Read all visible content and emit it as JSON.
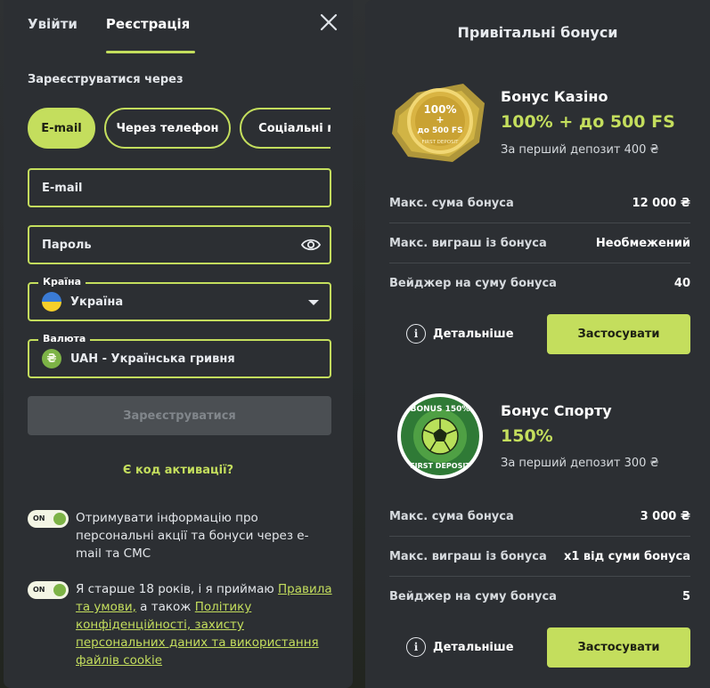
{
  "left": {
    "tabs": [
      "Увійти",
      "Реєстрація"
    ],
    "active_tab": 1,
    "register_via": "Зареєструватися через",
    "methods": [
      "E-mail",
      "Через телефон",
      "Соціальні м"
    ],
    "email": {
      "placeholder": "E-mail",
      "value": ""
    },
    "password": {
      "placeholder": "Пароль",
      "value": ""
    },
    "country": {
      "label": "Країна",
      "value": "Україна"
    },
    "currency": {
      "label": "Валюта",
      "value": "UAH - Українська гривня",
      "symbol": "₴"
    },
    "submit": "Зареєструватися",
    "activation_code": "Є код активації?",
    "toggles": [
      {
        "state": "ON",
        "text": "Отримувати інформацію про персональні акції та бонуси через e-mail та СМС"
      },
      {
        "state": "ON",
        "text_before": "Я старше 18 років, і я приймаю ",
        "link1": "Правила та умови,",
        "text_mid": " а також ",
        "link2": "Політику конфіденційності, захисту персональних даних та використання файлів cookie"
      }
    ]
  },
  "right": {
    "title": "Привітальні бонуси",
    "bonuses": [
      {
        "name": "Бонус Казіно",
        "amount": "100% + до 500 FS",
        "subtitle": "За перший депозит 400 ₴",
        "badge_lines": [
          "100%",
          "+",
          "до 500 FS",
          "FIRST DEPOSIT"
        ],
        "rows": [
          {
            "key": "Макс. сума бонуса",
            "value": "12 000 ₴"
          },
          {
            "key": "Макс. виграш із бонуса",
            "value": "Необмежений"
          },
          {
            "key": "Вейджер на суму бонуса",
            "value": "40"
          }
        ],
        "details": "Детальніше",
        "apply": "Застосувати"
      },
      {
        "name": "Бонус Спорту",
        "amount": "150%",
        "subtitle": "За перший депозит 300 ₴",
        "badge_lines": [
          "BONUS 150%",
          "FIRST DEPOSIT"
        ],
        "rows": [
          {
            "key": "Макс. сума бонуса",
            "value": "3 000 ₴"
          },
          {
            "key": "Макс. виграш із бонуса",
            "value": "x1 від суми бонуса"
          },
          {
            "key": "Вейджер на суму бонуса",
            "value": "5"
          }
        ],
        "details": "Детальніше",
        "apply": "Застосувати"
      }
    ]
  },
  "colors": {
    "accent": "#c4de5d",
    "panel": "#2c2f33",
    "disabled": "#4b4f53"
  }
}
